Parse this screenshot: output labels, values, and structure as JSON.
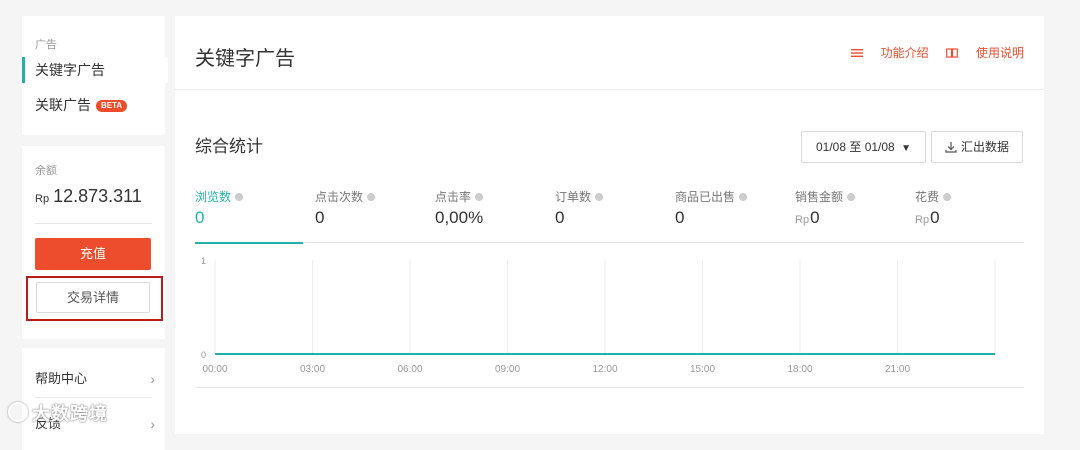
{
  "sidebar": {
    "ads_section_label": "广告",
    "nav_items": [
      {
        "label": "关键字广告",
        "active": true
      },
      {
        "label": "关联广告",
        "badge": "BETA"
      }
    ],
    "balance_label": "余额",
    "balance_currency": "Rp",
    "balance_value": "12.873.311",
    "topup_label": "充值",
    "transaction_detail_label": "交易详情",
    "help_items": [
      {
        "label": "帮助中心"
      },
      {
        "label": "反馈"
      }
    ]
  },
  "main": {
    "title": "关键字广告",
    "links": {
      "intro": "功能介绍",
      "manual": "使用说明"
    },
    "stats_title": "综合统计",
    "date_range": "01/08 至 01/08",
    "export_label": "汇出数据",
    "metrics": [
      {
        "label": "浏览数",
        "value": "0",
        "currency": "",
        "active": true
      },
      {
        "label": "点击次数",
        "value": "0",
        "currency": ""
      },
      {
        "label": "点击率",
        "value": "0,00%",
        "currency": ""
      },
      {
        "label": "订单数",
        "value": "0",
        "currency": ""
      },
      {
        "label": "商品已出售",
        "value": "0",
        "currency": ""
      },
      {
        "label": "销售金额",
        "value": "0",
        "currency": "Rp"
      },
      {
        "label": "花费",
        "value": "0",
        "currency": "Rp"
      }
    ]
  },
  "chart_data": {
    "type": "line",
    "x": [
      "00:00",
      "03:00",
      "06:00",
      "09:00",
      "12:00",
      "15:00",
      "18:00",
      "21:00"
    ],
    "y_ticks": [
      "1",
      "0"
    ],
    "ylim": [
      0,
      1
    ],
    "series": [
      {
        "values": [
          0,
          0,
          0,
          0,
          0,
          0,
          0,
          0
        ]
      }
    ],
    "grid": true,
    "line_color": "#20b2aa"
  },
  "watermark": "大数跨境"
}
